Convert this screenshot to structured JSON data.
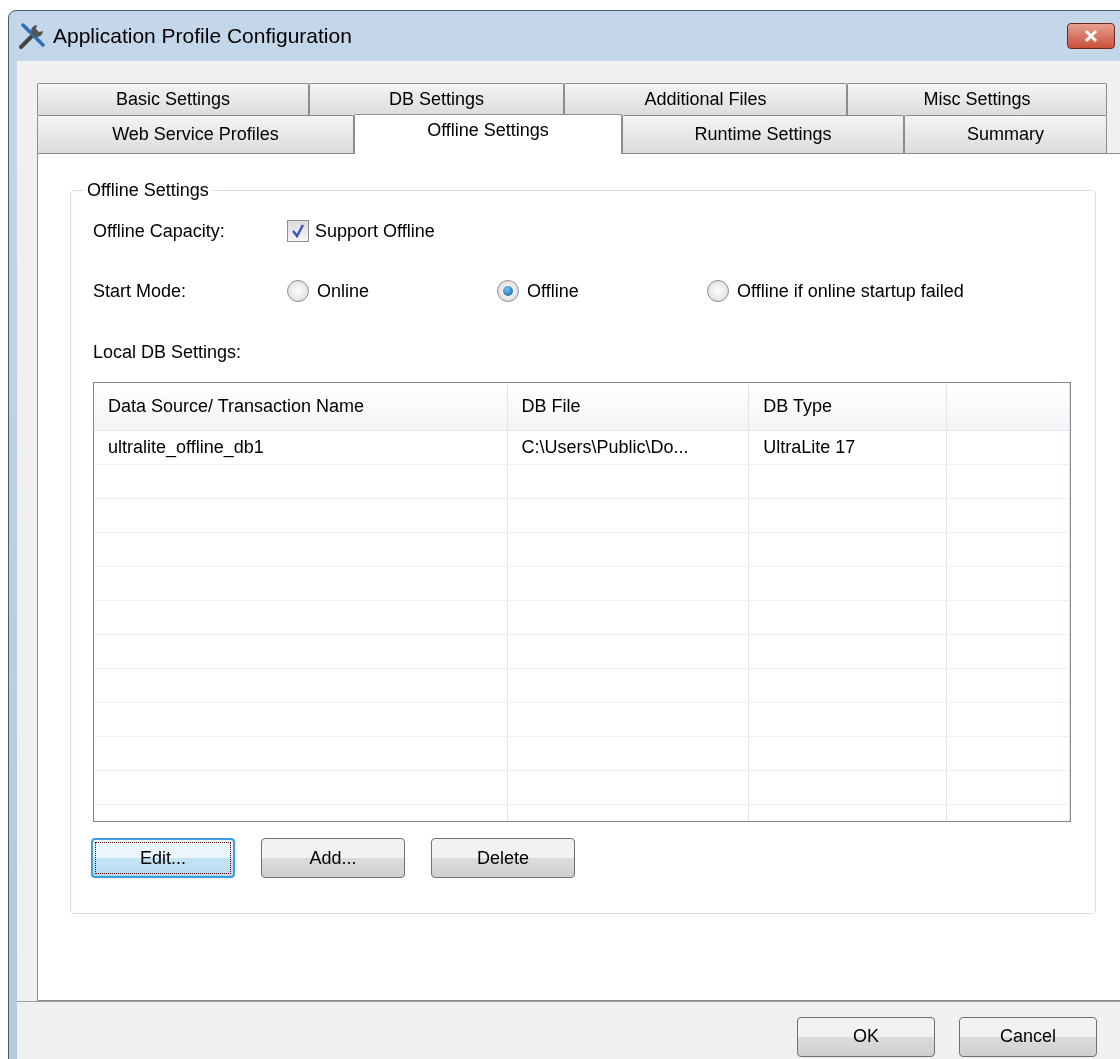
{
  "window": {
    "title": "Application Profile Configuration"
  },
  "tab_rows": [
    [
      {
        "label": "Basic Settings",
        "selected": false
      },
      {
        "label": "DB Settings",
        "selected": false
      },
      {
        "label": "Additional Files",
        "selected": false
      },
      {
        "label": "Misc Settings",
        "selected": false
      }
    ],
    [
      {
        "label": "Web Service Profiles",
        "selected": false
      },
      {
        "label": "Offline Settings",
        "selected": true
      },
      {
        "label": "Runtime Settings",
        "selected": false
      },
      {
        "label": "Summary",
        "selected": false
      }
    ]
  ],
  "group": {
    "title": "Offline Settings",
    "offline_capacity": {
      "label": "Offline Capacity:",
      "checkbox": {
        "label": "Support Offline",
        "checked": true
      }
    },
    "start_mode": {
      "label": "Start Mode:",
      "options": [
        {
          "label": "Online",
          "selected": false
        },
        {
          "label": "Offline",
          "selected": true
        },
        {
          "label": "Offline if online startup failed",
          "selected": false
        }
      ]
    },
    "local_db_label": "Local DB Settings:",
    "table": {
      "columns": [
        "Data Source/ Transaction Name",
        "DB File",
        "DB Type"
      ],
      "rows": [
        [
          "ultralite_offline_db1",
          "C:\\Users\\Public\\Do...",
          "UltraLite 17"
        ]
      ]
    },
    "buttons": [
      {
        "label": "Edit...",
        "focused": true
      },
      {
        "label": "Add...",
        "focused": false
      },
      {
        "label": "Delete",
        "focused": false
      }
    ]
  },
  "footer_buttons": [
    "OK",
    "Cancel"
  ]
}
